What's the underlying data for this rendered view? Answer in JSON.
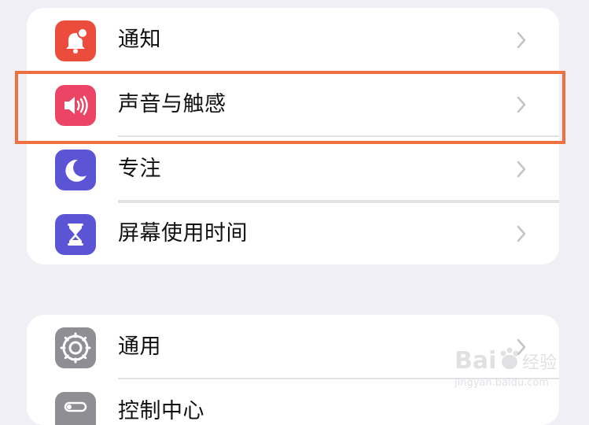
{
  "settings_group_1": [
    {
      "label": "通知",
      "icon": "bell-badge-icon",
      "color": "#ec4c3c"
    },
    {
      "label": "声音与触感",
      "icon": "speaker-wave-icon",
      "color": "#ec4465"
    },
    {
      "label": "专注",
      "icon": "moon-icon",
      "color": "#5b54d4"
    },
    {
      "label": "屏幕使用时间",
      "icon": "hourglass-icon",
      "color": "#5b54d4"
    }
  ],
  "settings_group_2": [
    {
      "label": "通用",
      "icon": "gear-icon",
      "color": "#8e8e93"
    },
    {
      "label": "控制中心",
      "icon": "control-center-icon",
      "color": "#8e8e93"
    }
  ],
  "highlight_color": "#ee7040",
  "watermark_text": "Bai 经验"
}
